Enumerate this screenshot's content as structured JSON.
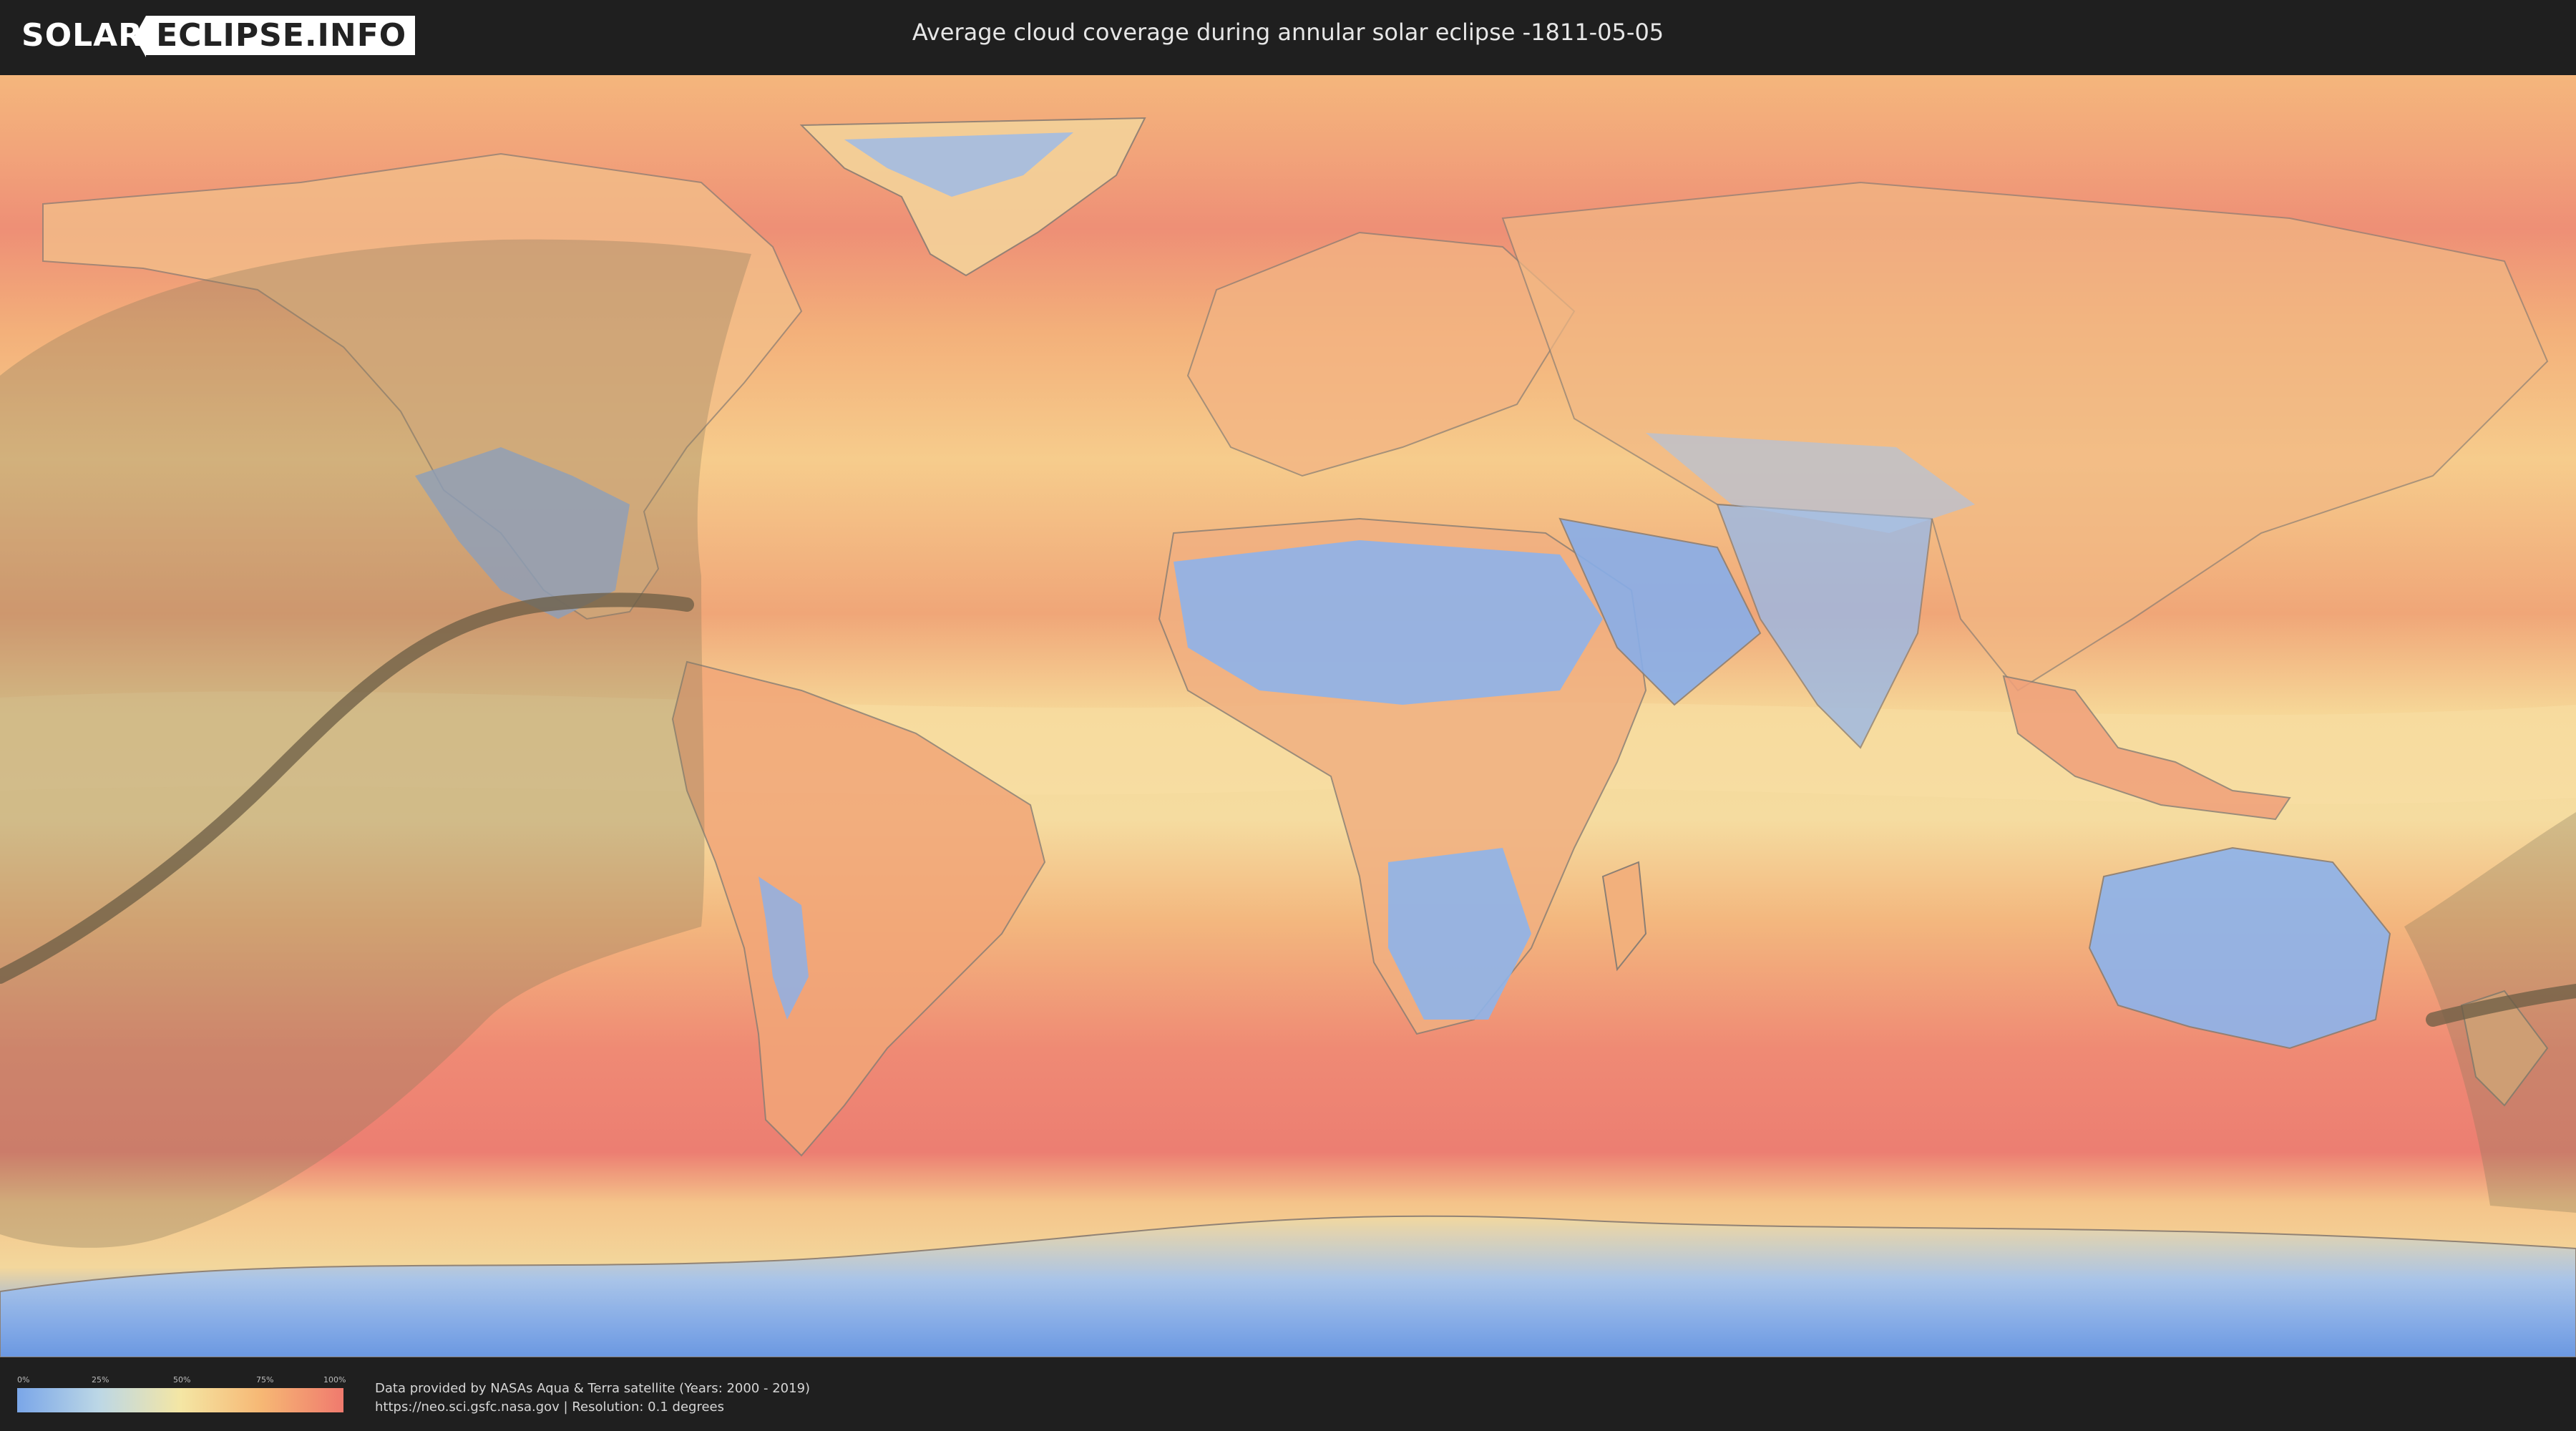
{
  "header": {
    "logo": {
      "part1": "SOLAR",
      "part2": "ECLIPSE.INFO"
    },
    "title": "Average cloud coverage during annular solar eclipse -1811-05-05"
  },
  "map": {
    "type": "world cloud coverage map",
    "overlay": "annular eclipse visibility zone with central path"
  },
  "legend": {
    "ticks": [
      "0%",
      "25%",
      "50%",
      "75%",
      "100%"
    ],
    "colors": [
      "#7aa6e8",
      "#bcd7e6",
      "#f4e6a4",
      "#f6b774",
      "#f07a6e"
    ]
  },
  "credits": {
    "line1": "Data provided by NASAs Aqua & Terra satellite (Years: 2000 - 2019)",
    "line2": "https://neo.sci.gsfc.nasa.gov | Resolution: 0.1 degrees"
  }
}
